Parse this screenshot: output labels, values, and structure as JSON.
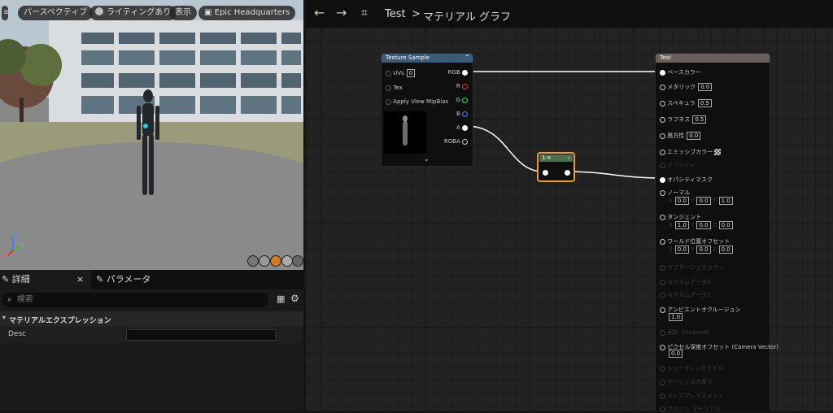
{
  "viewport": {
    "perspective_label": "パースペクティブ",
    "lighting_label": "ライティングあり",
    "show_label": "表示",
    "level_label": "Epic Headquarters"
  },
  "details_panel": {
    "tab_details": "詳細",
    "tab_parameters": "パラメータ",
    "search_placeholder": "検索",
    "section_title": "マテリアルエクスプレッション",
    "desc_label": "Desc",
    "desc_value": ""
  },
  "graph": {
    "breadcrumb_root": "Test",
    "breadcrumb_separator": ">",
    "breadcrumb_current": "マテリアル グラフ",
    "texture_node": {
      "title": "Texture Sample",
      "inputs": [
        "UVs",
        "Tex",
        "Apply View MipBias"
      ],
      "uvs_value": "0",
      "outputs": [
        "RGB",
        "R",
        "G",
        "B",
        "A",
        "RGBA"
      ]
    },
    "oneminus_node": {
      "title": "1-x"
    },
    "result_node": {
      "title": "Test",
      "pins": {
        "base_color": "ベースカラー",
        "metallic": "メタリック",
        "metallic_value": "0.0",
        "specular": "スペキュラ",
        "specular_value": "0.5",
        "roughness": "ラフネス",
        "roughness_value": "0.5",
        "anisotropy": "異方性",
        "anisotropy_value": "0.0",
        "emissive": "エミッシブカラー",
        "opacity": "オパシティ",
        "opacity_mask": "オパシティマスク",
        "normal": "ノーマル",
        "tangent": "タンジェント",
        "wpo": "ワールド位置オフセット",
        "subsurface": "サブサーフェスカラー",
        "custom0": "カスタムデータ0",
        "custom1": "カスタムデータ1",
        "ao": "アンビエントオクルージョン",
        "ao_value": "1.0",
        "refraction": "屈折 (Disabled)",
        "pdo": "ピクセル深度オフセット (Camera Vector)",
        "pdo_value": "0.0",
        "shading_model": "シェーディングモデル",
        "surface_thickness": "サーフェスの厚さ",
        "displacement": "ディスプレイスメント",
        "front_material": "フロント マテリアル"
      },
      "x_label": "X",
      "y_label": "Y",
      "z_label": "Z",
      "normal_values": [
        "0.0",
        "0.0",
        "1.0"
      ],
      "tangent_values": [
        "1.0",
        "0.0",
        "0.0"
      ],
      "wpo_values": [
        "0.0",
        "0.0",
        "0.0"
      ]
    }
  },
  "axis": {
    "x": "X",
    "y": "Y",
    "z": "Z"
  }
}
